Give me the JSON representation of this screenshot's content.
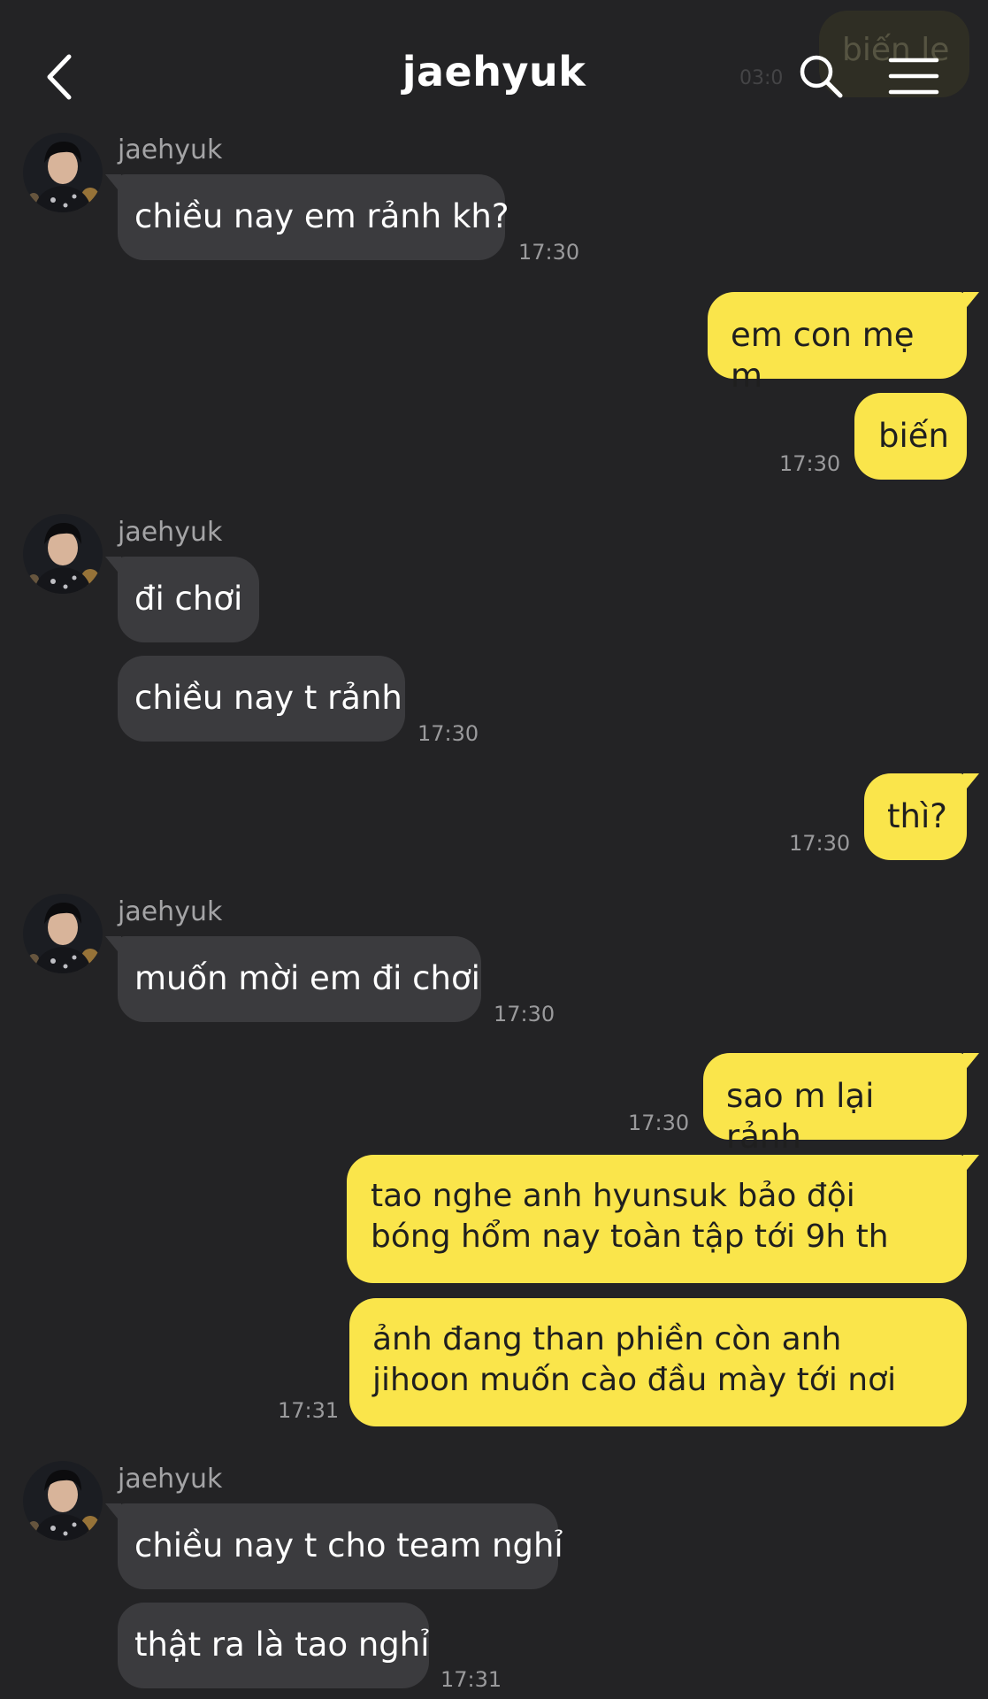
{
  "header": {
    "title": "jaehyuk",
    "back_icon": "chevron-left-icon",
    "search_icon": "search-icon",
    "menu_icon": "hamburger-menu-icon",
    "ghost_text": "biến le",
    "ghost_time": "03:0"
  },
  "colors": {
    "background": "#232325",
    "incoming_bubble": "#3b3b3e",
    "outgoing_bubble": "#fae54b",
    "timestamp": "#9a9a9c"
  },
  "messages": [
    {
      "sender": "jaehyuk",
      "text": "chiều nay em rảnh kh?",
      "time": "17:30"
    },
    {
      "text": "em con mẹ m"
    },
    {
      "text": "biến",
      "time": "17:30"
    },
    {
      "sender": "jaehyuk",
      "text": "đi chơi"
    },
    {
      "text": "chiều nay t rảnh",
      "time": "17:30"
    },
    {
      "text": "thì?",
      "time": "17:30"
    },
    {
      "sender": "jaehyuk",
      "text": "muốn mời em đi chơi",
      "time": "17:30"
    },
    {
      "text": "sao m lại rảnh",
      "time": "17:30"
    },
    {
      "text": "tao nghe anh hyunsuk bảo đội bóng hổm nay toàn tập tới 9h th"
    },
    {
      "text": "ảnh đang than phiền còn anh jihoon muốn cào đầu mày tới nơi",
      "time": "17:31"
    },
    {
      "sender": "jaehyuk",
      "text": "chiều nay t cho team nghỉ"
    },
    {
      "text": "thật ra là tao nghỉ",
      "time": "17:31"
    }
  ]
}
